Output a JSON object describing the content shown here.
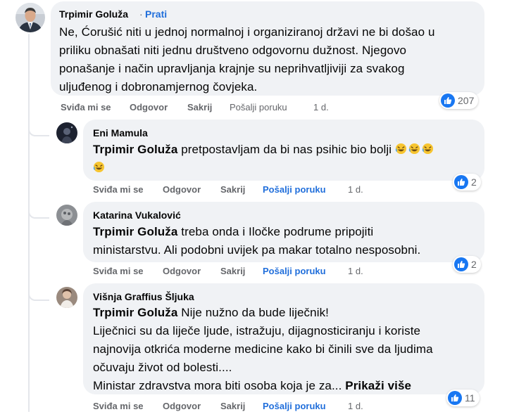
{
  "comments": [
    {
      "author": "Trpimir Goluža",
      "follow_label": "Prati",
      "follow_dot": "·",
      "lines": [
        "Ne, Ćorušić niti u jednoj normalnoj i organiziranoj državi ne bi došao u",
        "priliku obnašati niti jednu društveno odgovornu dužnost. Njegovo",
        "ponašanje i način upravljanja krajnje su neprihvatljiviji za svakog",
        "uljuđenog i dobronamjernog čovjeka."
      ],
      "reaction_count": "207",
      "actions": {
        "like": "Sviđa mi se",
        "reply": "Odgovor",
        "hide": "Sakrij",
        "message": "Pošalji poruku",
        "time": "1 d."
      }
    },
    {
      "author": "Eni Mamula",
      "mention": "Trpimir Goluža",
      "text": " pretpostavljam da bi nas psihic bio bolji ",
      "emoji": "rolling-on-floor-laughing-emoji",
      "reaction_count": "2",
      "actions": {
        "like": "Sviđa mi se",
        "reply": "Odgovor",
        "hide": "Sakrij",
        "message": "Pošalji poruku",
        "time": "1 d."
      }
    },
    {
      "author": "Katarina Vukalović",
      "mention": "Trpimir Goluža",
      "line1": " treba onda i Iločke podrume pripojiti",
      "line2": "ministarstvu. Ali podobni uvijek pa makar totalno nesposobni.",
      "reaction_count": "2",
      "actions": {
        "like": "Sviđa mi se",
        "reply": "Odgovor",
        "hide": "Sakrij",
        "message": "Pošalji poruku",
        "time": "1 d."
      }
    },
    {
      "author": "Višnja Graffius Šljuka",
      "mention": "Trpimir Goluža",
      "line1": " Nije nužno da bude liječnik!",
      "line2": "Liječnici su da liječe ljude, istražuju, dijagnosticiranju i koriste",
      "line3": "najnovija otkrića moderne medicine kako bi činili sve da ljudima",
      "line4": "očuvaju život od bolesti....",
      "line5": "Ministar zdravstva mora biti osoba koja je za... ",
      "see_more": "Prikaži više",
      "reaction_count": "11",
      "actions": {
        "like": "Sviđa mi se",
        "reply": "Odgovor",
        "hide": "Sakrij",
        "message": "Pošalji poruku",
        "time": "1 d."
      }
    }
  ],
  "colors": {
    "bubble": "#f0f2f5",
    "link": "#216fdb",
    "meta": "#65676b",
    "like": "#1877f2"
  },
  "icons": {
    "like": "thumbs-up-icon",
    "emoji": "rolling-on-floor-laughing-emoji"
  }
}
